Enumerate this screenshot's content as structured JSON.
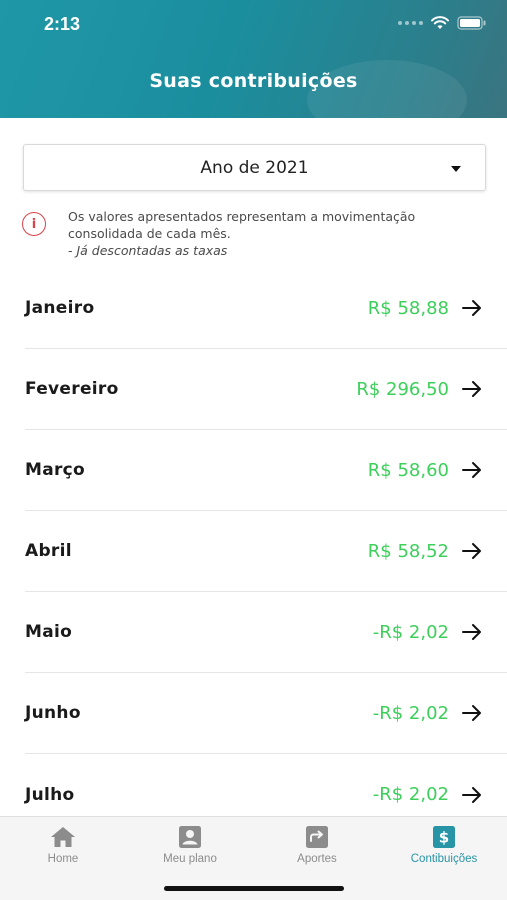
{
  "status_bar": {
    "time": "2:13"
  },
  "header": {
    "title": "Suas contribuições"
  },
  "year_select": {
    "value": "Ano de 2021"
  },
  "info": {
    "icon": "info-icon",
    "text": "Os valores apresentados representam a movimentação consolidada de cada mês.",
    "note": "- Já descontadas as taxas"
  },
  "months": [
    {
      "name": "Janeiro",
      "value": "R$ 58,88"
    },
    {
      "name": "Fevereiro",
      "value": "R$ 296,50"
    },
    {
      "name": "Março",
      "value": "R$ 58,60"
    },
    {
      "name": "Abril",
      "value": "R$ 58,52"
    },
    {
      "name": "Maio",
      "value": "-R$ 2,02"
    },
    {
      "name": "Junho",
      "value": "-R$ 2,02"
    },
    {
      "name": "Julho",
      "value": "-R$ 2,02"
    }
  ],
  "tabbar": {
    "home": "Home",
    "plan": "Meu plano",
    "aportes": "Aportes",
    "contribuicoes": "Contibuições"
  },
  "colors": {
    "header": "#1f97a7",
    "value_green": "#3ccf5a",
    "active_tab": "#2895a6",
    "info_red": "#d8424a"
  }
}
